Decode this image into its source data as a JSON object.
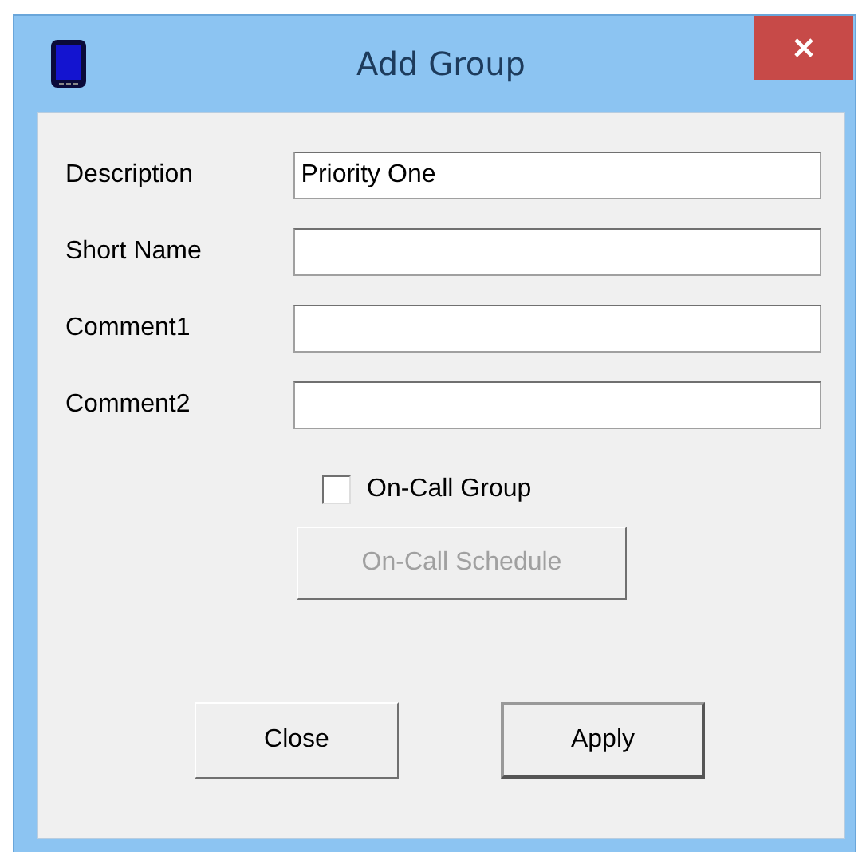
{
  "window": {
    "title": "Add Group"
  },
  "fields": [
    {
      "label": "Description",
      "value": "Priority One"
    },
    {
      "label": "Short Name"
    },
    {
      "label": "Comment1"
    },
    {
      "label": "Comment2"
    }
  ],
  "on_call_group": {
    "label": "On-Call Group",
    "checked": false
  },
  "schedule_button": {
    "label": "On-Call Schedule",
    "disabled": true
  },
  "buttons": [
    {
      "label": "Close",
      "default": false
    },
    {
      "label": "Apply",
      "default": true
    }
  ]
}
